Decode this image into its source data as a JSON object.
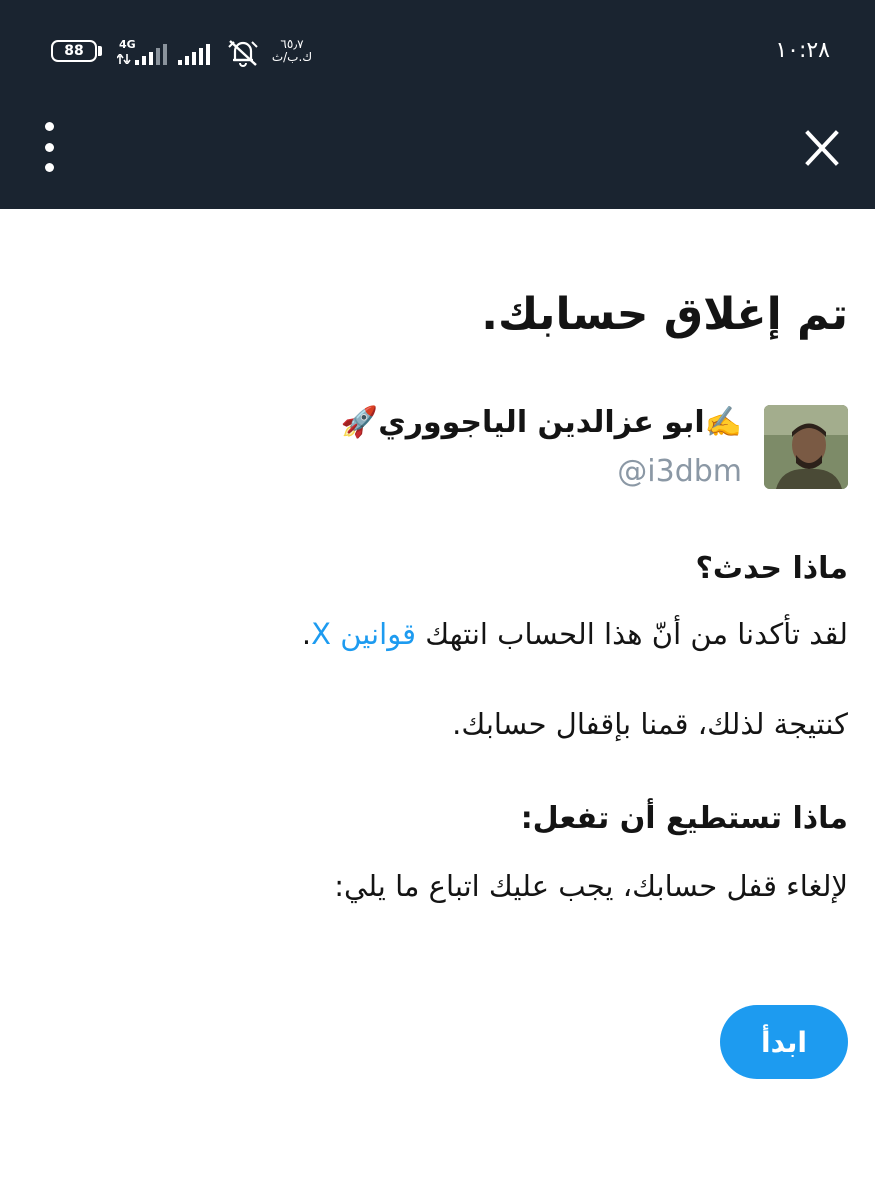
{
  "status_bar": {
    "battery": "88",
    "network": "4G",
    "speed_value": "٦٥٫٧",
    "speed_unit": "ك.ب/ث",
    "time": "١٠:٢٨"
  },
  "app_bar": {
    "close_icon": "x-close-icon",
    "menu_icon": "vertical-ellipsis-icon"
  },
  "page": {
    "title": "تم إغلاق حسابك.",
    "account": {
      "display_name": "✍️ابو عزالدين الياجووري🚀",
      "handle": "@i3dbm"
    },
    "what_happened": {
      "heading": "ماذا حدث؟",
      "line1_before": "لقد تأكدنا من أنّ هذا الحساب انتهك ",
      "line1_link": "قوانين X",
      "line1_after": ".",
      "line2": "كنتيجة لذلك، قمنا بإقفال حسابك."
    },
    "what_to_do": {
      "heading": "ماذا تستطيع أن تفعل:",
      "line1": "لإلغاء قفل حسابك، يجب عليك اتباع ما يلي:"
    },
    "start_button": "ابدأ"
  },
  "colors": {
    "top_bar": "#1a2430",
    "accent": "#1d9bf0",
    "muted": "#8b98a5"
  }
}
